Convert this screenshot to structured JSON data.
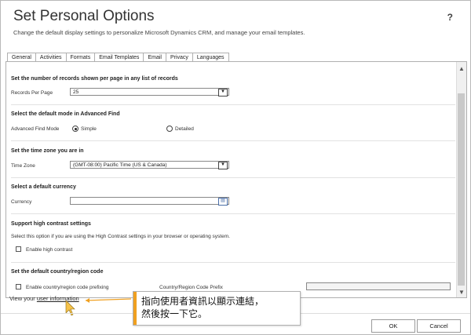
{
  "dialog": {
    "title": "Set Personal Options",
    "help": "?",
    "subtitle": "Change the default display settings to personalize Microsoft Dynamics CRM, and manage your email templates."
  },
  "tabs": [
    {
      "label": "General"
    },
    {
      "label": "Activities"
    },
    {
      "label": "Formats"
    },
    {
      "label": "Email Templates"
    },
    {
      "label": "Email"
    },
    {
      "label": "Privacy"
    },
    {
      "label": "Languages"
    }
  ],
  "sections": {
    "records": {
      "heading": "Set the number of records shown per page in any list of records",
      "label": "Records Per Page",
      "value": "25"
    },
    "advanced_find": {
      "heading": "Select the default mode in Advanced Find",
      "label": "Advanced Find Mode",
      "option_simple": "Simple",
      "option_detailed": "Detailed",
      "selected": "Simple"
    },
    "timezone": {
      "heading": "Set the time zone you are in",
      "label": "Time Zone",
      "value": "(GMT-08:00) Pacific Time (US & Canada)"
    },
    "currency": {
      "heading": "Select a default currency",
      "label": "Currency",
      "value": ""
    },
    "contrast": {
      "heading": "Support high contrast settings",
      "description": "Select this option if you are using the High Contrast settings in your browser or operating system.",
      "checkbox_label": "Enable high contrast",
      "checked": false
    },
    "country": {
      "heading": "Set the default country/region code",
      "checkbox_label": "Enable country/region code prefixing",
      "checked": false,
      "prefix_label": "Country/Region Code Prefix",
      "prefix_value": ""
    }
  },
  "footer": {
    "prefix_text": "View your ",
    "link_text": "user information",
    "ok": "OK",
    "cancel": "Cancel"
  },
  "callout": {
    "line1": "指向使用者資訊以顯示連結，",
    "line2": "然後按一下它。",
    "accent": "#f0a020"
  }
}
